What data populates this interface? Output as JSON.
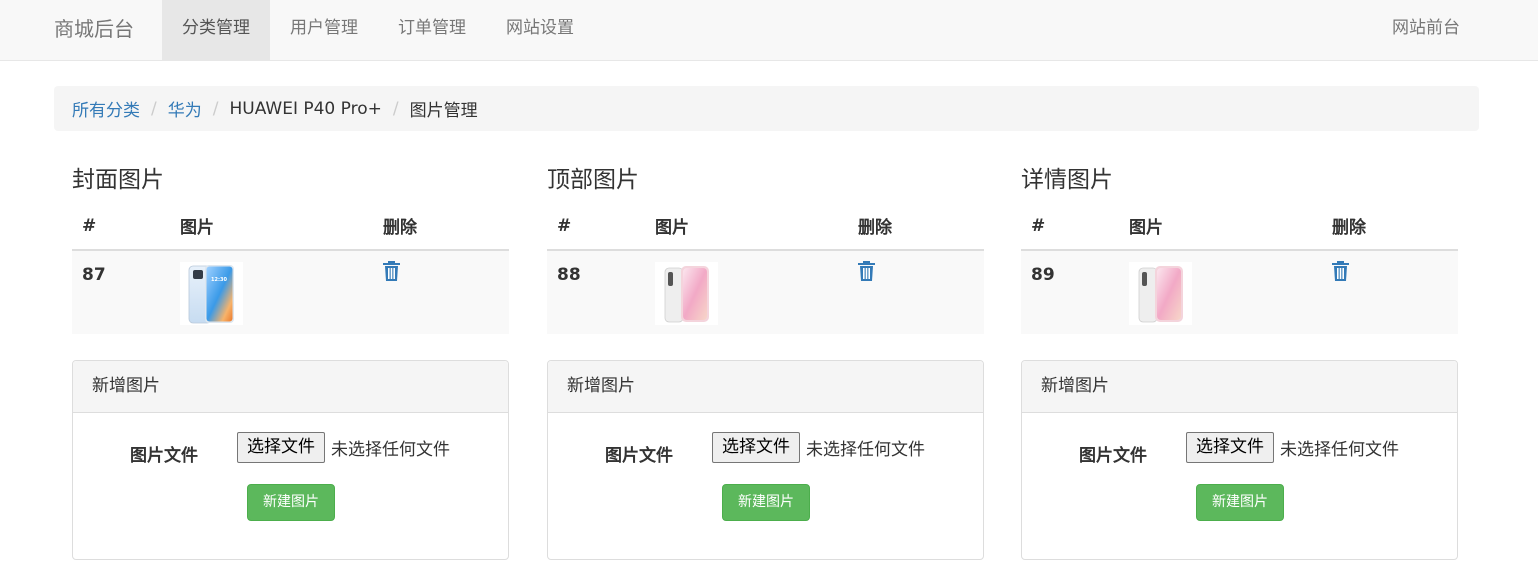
{
  "navbar": {
    "brand": "商城后台",
    "items": [
      "分类管理",
      "用户管理",
      "订单管理",
      "网站设置"
    ],
    "active_index": 0,
    "right_link": "网站前台"
  },
  "breadcrumb": {
    "links": [
      "所有分类",
      "华为"
    ],
    "product": "HUAWEI P40 Pro+",
    "current": "图片管理"
  },
  "table_headers": {
    "id": "#",
    "image": "图片",
    "delete": "删除"
  },
  "sections": [
    {
      "title": "封面图片",
      "row": {
        "id": "87",
        "image": "phone-p40-thumbnail"
      }
    },
    {
      "title": "顶部图片",
      "row": {
        "id": "88",
        "image": "phone-mi10-thumbnail"
      }
    },
    {
      "title": "详情图片",
      "row": {
        "id": "89",
        "image": "phone-mi10-thumbnail"
      }
    }
  ],
  "upload_panel": {
    "heading": "新增图片",
    "field_label": "图片文件",
    "file_button": "选择文件",
    "file_status": "未选择任何文件",
    "submit": "新建图片"
  },
  "colors": {
    "link": "#337ab7",
    "success": "#5cb85c",
    "navbar_bg": "#f8f8f8"
  },
  "icons": {
    "delete": "trash-icon"
  }
}
